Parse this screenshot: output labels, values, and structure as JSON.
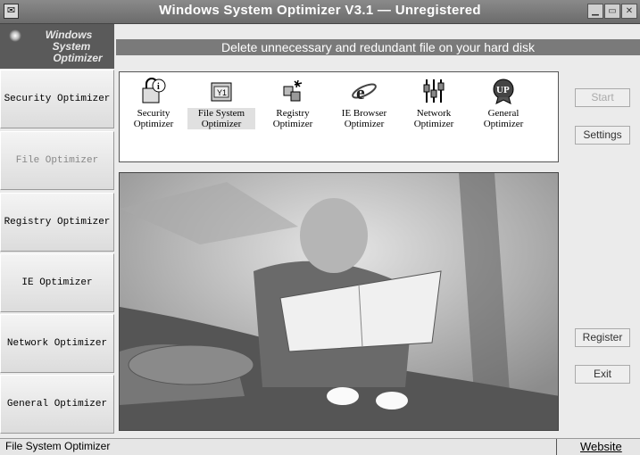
{
  "window": {
    "title": "Windows System Optimizer V3.1 — Unregistered",
    "controls": [
      "minimize-icon",
      "maximize-icon",
      "close-icon"
    ]
  },
  "logo": {
    "line1": "Windows",
    "line2": "System",
    "line3": "Optimizer"
  },
  "banner": "Delete unnecessary and redundant file on your hard disk",
  "nav": [
    {
      "label": "Security Optimizer"
    },
    {
      "label": "File Optimizer"
    },
    {
      "label": "Registry Optimizer"
    },
    {
      "label": "IE Optimizer"
    },
    {
      "label": "Network Optimizer"
    },
    {
      "label": "General Optimizer"
    }
  ],
  "nav_selected": "File Optimizer",
  "tools": [
    {
      "line1": "Security",
      "line2": "Optimizer",
      "icon": "security-info-icon"
    },
    {
      "line1": "File System",
      "line2": "Optimizer",
      "icon": "file-system-icon"
    },
    {
      "line1": "Registry",
      "line2": "Optimizer",
      "icon": "registry-icon"
    },
    {
      "line1": "IE Browser",
      "line2": "Optimizer",
      "icon": "ie-browser-icon"
    },
    {
      "line1": "Network",
      "line2": "Optimizer",
      "icon": "network-icon"
    },
    {
      "line1": "General",
      "line2": "Optimizer",
      "icon": "up-badge-icon",
      "badge": "UP"
    }
  ],
  "tool_selected": "File System Optimizer",
  "buttons": {
    "start": "Start",
    "settings": "Settings",
    "register": "Register",
    "exit": "Exit"
  },
  "status": {
    "text": "File System Optimizer",
    "link": "Website"
  }
}
